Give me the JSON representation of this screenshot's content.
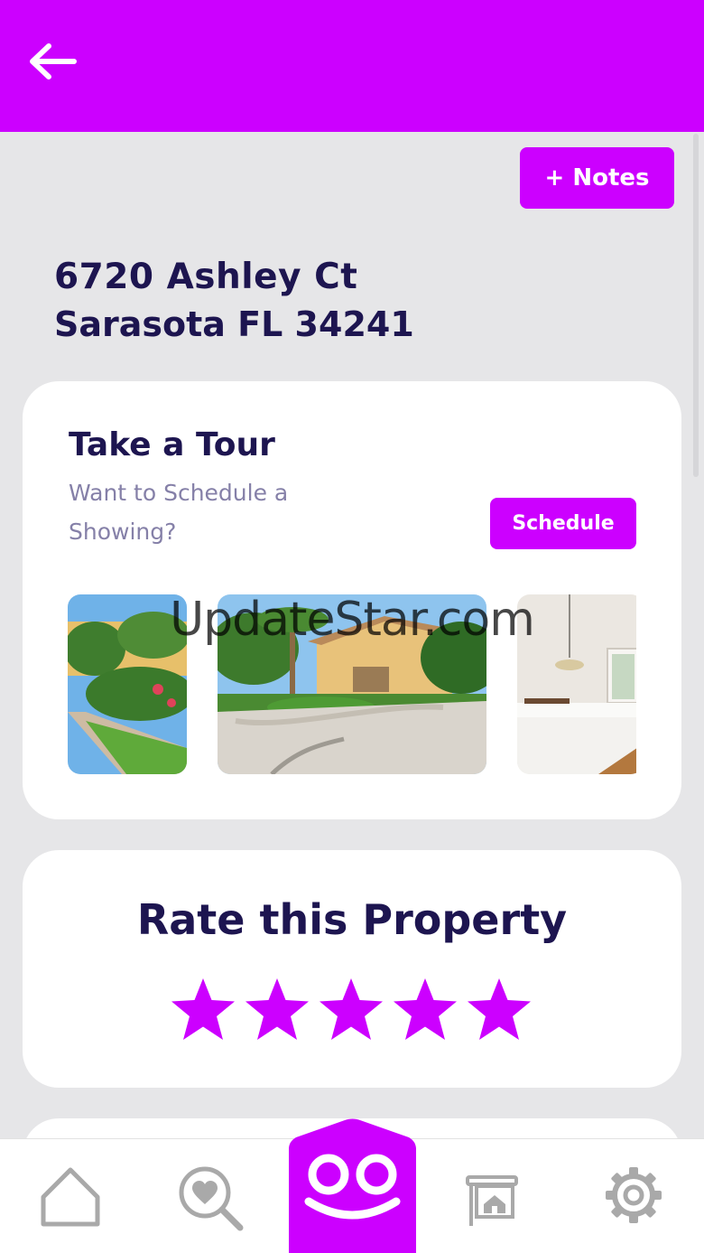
{
  "header": {
    "back_icon": "back-arrow-icon",
    "background": "#cc00ff"
  },
  "notes_button": {
    "label": "+ Notes"
  },
  "address": {
    "street": "6720 Ashley Ct",
    "city_state_zip": "Sarasota FL 34241"
  },
  "tour": {
    "title": "Take a Tour",
    "subtitle": "Want to Schedule a Showing?",
    "schedule_label": "Schedule",
    "photos": [
      "front-yard-photo",
      "house-exterior-photo",
      "interior-room-photo"
    ]
  },
  "watermark": "UpdateStar.com",
  "rating": {
    "title": "Rate this Property",
    "stars_total": 5,
    "stars_filled": 5,
    "star_color": "#cc00ff"
  },
  "bottom_nav": {
    "items": [
      {
        "icon": "home-icon"
      },
      {
        "icon": "search-heart-icon"
      },
      {
        "icon": "smile-face-icon"
      },
      {
        "icon": "listing-sign-icon"
      },
      {
        "icon": "gear-icon"
      }
    ]
  },
  "colors": {
    "accent": "#cc00ff",
    "text_dark": "#1d1550",
    "text_muted": "#8580a8",
    "background": "#e6e6e8"
  }
}
